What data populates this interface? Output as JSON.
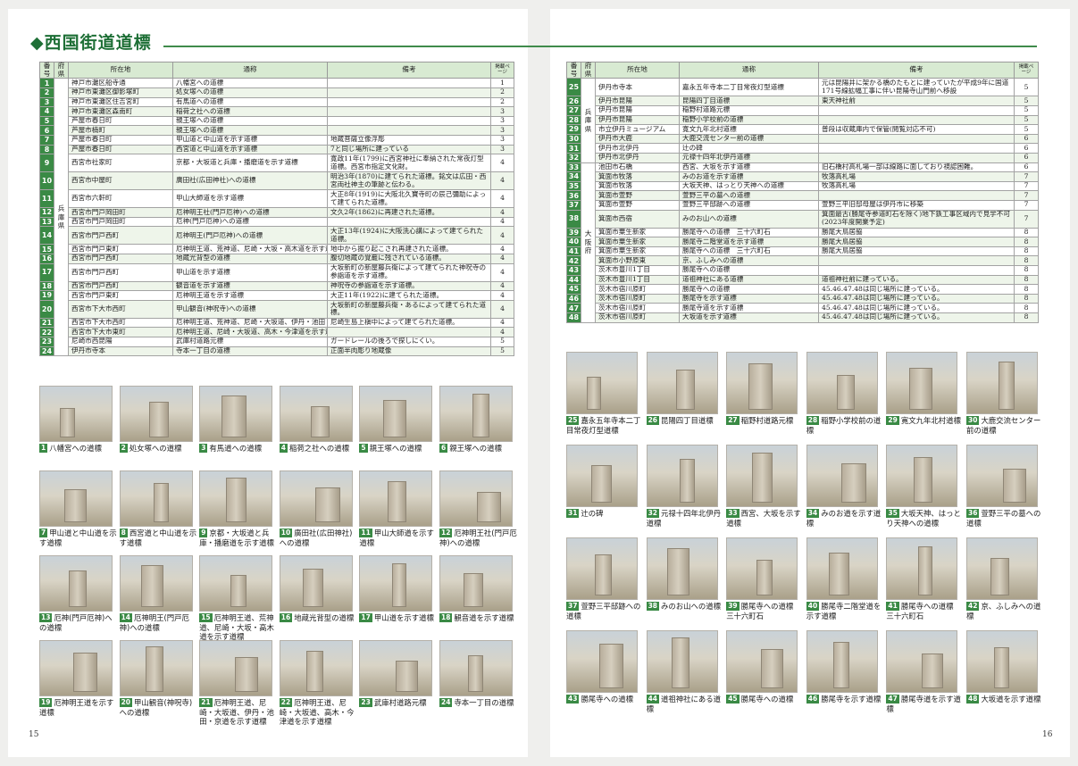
{
  "section_title": "◆西国街道道標",
  "table_headers": {
    "num": "番号",
    "pref": "府県",
    "loc": "所在地",
    "name": "通称",
    "note": "備考",
    "page": "掲載ページ"
  },
  "left_pref": "兵庫県",
  "right_prefs": [
    {
      "label": "兵庫県",
      "span": 8
    },
    {
      "label": "大阪府",
      "span": 16
    }
  ],
  "left_rows": [
    {
      "n": "1",
      "loc": "神戸市灘区船寺通",
      "name": "八幡宮への道標",
      "note": "",
      "page": "1"
    },
    {
      "n": "2",
      "loc": "神戸市東灘区御影塚町",
      "name": "処女塚への道標",
      "note": "",
      "page": "2"
    },
    {
      "n": "3",
      "loc": "神戸市東灘区住吉宮町",
      "name": "有馬道への道標",
      "note": "",
      "page": "2"
    },
    {
      "n": "4",
      "loc": "神戸市東灘区森南町",
      "name": "稲荷之社への道標",
      "note": "",
      "page": "3"
    },
    {
      "n": "5",
      "loc": "芦屋市春日町",
      "name": "親王塚への道標",
      "note": "",
      "page": "3"
    },
    {
      "n": "6",
      "loc": "芦屋市楠町",
      "name": "親王塚への道標",
      "note": "",
      "page": "3"
    },
    {
      "n": "7",
      "loc": "芦屋市春日町",
      "name": "甲山道と中山道を示す道標",
      "note": "地蔵菩薩立像浮彫",
      "page": "3"
    },
    {
      "n": "8",
      "loc": "芦屋市春日町",
      "name": "西宮道と中山道を示す道標",
      "note": "7と同じ場所に建っている",
      "page": "3"
    },
    {
      "n": "9",
      "loc": "西宮市社家町",
      "name": "京都・大坂道と兵庫・播磨道を示す道標",
      "note": "寛政11年(1799)に西宮神社に奉納された常夜灯型道標。西宮市指定文化財。",
      "page": "4"
    },
    {
      "n": "10",
      "loc": "西宮市中屋町",
      "name": "廣田社(広田神社)への道標",
      "note": "明治3年(1870)に建てられた道標。銘文は広田・西宮両社神主の筆跡と伝わる。",
      "page": "4"
    },
    {
      "n": "11",
      "loc": "西宮市六軒町",
      "name": "甲山大師道を示す道標",
      "note": "大正8年(1919)に大阪北久寶寺町の辰己彌助によって建てられた道標。",
      "page": "4"
    },
    {
      "n": "12",
      "loc": "西宮市門戸岡田町",
      "name": "厄神明王社(門戸厄神)への道標",
      "note": "文久2年(1862)に再建された道標。",
      "page": "4"
    },
    {
      "n": "13",
      "loc": "西宮市門戸岡田町",
      "name": "厄神(門戸厄神)への道標",
      "note": "",
      "page": "4"
    },
    {
      "n": "14",
      "loc": "西宮市門戸西町",
      "name": "厄神明王(門戸厄神)への道標",
      "note": "大正13年(1924)に大阪洗心講によって建てられた道標。",
      "page": "4"
    },
    {
      "n": "15",
      "loc": "西宮市門戸東町",
      "name": "厄神明王道、荒神道、尼崎・大坂・高木道を示す道標",
      "note": "地中から掘り起こされ再建された道標。",
      "page": "4"
    },
    {
      "n": "16",
      "loc": "西宮市門戸西町",
      "name": "地蔵光背型の道標",
      "note": "腹切地蔵の覚龕に残されている道標。",
      "page": "4"
    },
    {
      "n": "17",
      "loc": "西宮市門戸西町",
      "name": "甲山道を示す道標",
      "note": "大坂新町の新屋藤兵衛によって建てられた神呪寺の参詣道を示す道標。",
      "page": "4"
    },
    {
      "n": "18",
      "loc": "西宮市門戸西町",
      "name": "観音道を示す道標",
      "note": "神呪寺の参詣道を示す道標。",
      "page": "4"
    },
    {
      "n": "19",
      "loc": "西宮市門戸東町",
      "name": "厄神明王道を示す道標",
      "note": "大正11年(1922)に建てられた道標。",
      "page": "4"
    },
    {
      "n": "20",
      "loc": "西宮市下大市西町",
      "name": "甲山観音(神呪寺)への道標",
      "note": "大坂新町の新屋藤兵衛・あるによって建てられた道標。",
      "page": "4"
    },
    {
      "n": "21",
      "loc": "西宮市下大市西町",
      "name": "厄神明王道、荒神道、尼崎・大坂道、伊丹・池田・京道を示す道標",
      "note": "尼崎生島上槇中によって建てられた道標。",
      "page": "4"
    },
    {
      "n": "22",
      "loc": "西宮市下大市東町",
      "name": "厄神明王道、尼崎・大坂道、高木・今津道を示す道標",
      "note": "",
      "page": "4"
    },
    {
      "n": "23",
      "loc": "尼崎市西昆陽",
      "name": "武庫村道路元標",
      "note": "ガードレールの後ろで探しにくい。",
      "page": "5"
    },
    {
      "n": "24",
      "loc": "伊丹市寺本",
      "name": "寺本一丁目の道標",
      "note": "正面半肉彫り地蔵像",
      "page": "5"
    }
  ],
  "right_rows": [
    {
      "n": "25",
      "loc": "伊丹市寺本",
      "name": "嘉永五年寺本二丁目常夜灯型道標",
      "note": "元は昆陽井に架かる橋のたもとに建っていたが平成9年に国道171号線拡幅工事に伴い昆陽寺山門前へ移設",
      "page": "5"
    },
    {
      "n": "26",
      "loc": "伊丹市昆陽",
      "name": "昆陽四丁目道標",
      "note": "東天神社前",
      "page": "5"
    },
    {
      "n": "27",
      "loc": "伊丹市昆陽",
      "name": "稲野村道路元標",
      "note": "",
      "page": "5"
    },
    {
      "n": "28",
      "loc": "伊丹市昆陽",
      "name": "稲野小学校前の道標",
      "note": "",
      "page": "5"
    },
    {
      "n": "29",
      "loc": "市立伊丹ミュージアム",
      "name": "寛文九年北村道標",
      "note": "普段は収蔵庫内で保管(閲覧対応不可)",
      "page": "5"
    },
    {
      "n": "30",
      "loc": "伊丹市大鹿",
      "name": "大鹿交流センター前の道標",
      "note": "",
      "page": "6"
    },
    {
      "n": "31",
      "loc": "伊丹市北伊丹",
      "name": "辻の碑",
      "note": "",
      "page": "6"
    },
    {
      "n": "32",
      "loc": "伊丹市北伊丹",
      "name": "元禄十四年北伊丹道標",
      "note": "",
      "page": "6"
    },
    {
      "n": "33",
      "loc": "池田市石橋",
      "name": "西宮、大坂を示す道標",
      "note": "旧石橋村高札場一部は線路に面しており視認困難。",
      "page": "6"
    },
    {
      "n": "34",
      "loc": "箕面市牧落",
      "name": "みのお道を示す道標",
      "note": "牧落高札場",
      "page": "7"
    },
    {
      "n": "35",
      "loc": "箕面市牧落",
      "name": "大坂天神、はっとり天神への道標",
      "note": "牧落高札場",
      "page": "7"
    },
    {
      "n": "36",
      "loc": "箕面市萱野",
      "name": "萱野三平の墓への道標",
      "note": "",
      "page": "7"
    },
    {
      "n": "37",
      "loc": "箕面市萱野",
      "name": "萱野三平邸跡への道標",
      "note": "萱野三平旧邸母屋は伊丹市に移築",
      "page": "7"
    },
    {
      "n": "38",
      "loc": "箕面市西宿",
      "name": "みのお山への道標",
      "note": "箕面最古(勝尾寺参道町石を除く)地下鉄工事区域内で見学不可(2023年度開業予定)",
      "page": "7"
    },
    {
      "n": "39",
      "loc": "箕面市粟生新家",
      "name": "勝尾寺への道標　三十六町石",
      "note": "勝尾大鳥居脇",
      "page": "8"
    },
    {
      "n": "40",
      "loc": "箕面市粟生新家",
      "name": "勝尾寺二階堂道を示す道標",
      "note": "勝尾大鳥居脇",
      "page": "8"
    },
    {
      "n": "41",
      "loc": "箕面市粟生新家",
      "name": "勝尾寺への道標　三十六町石",
      "note": "勝尾大鳥居脇",
      "page": "8"
    },
    {
      "n": "42",
      "loc": "箕面市小野原東",
      "name": "京、ふしみへの道標",
      "note": "",
      "page": "8"
    },
    {
      "n": "43",
      "loc": "茨木市豊川1丁目",
      "name": "勝尾寺への道標",
      "note": "",
      "page": "8"
    },
    {
      "n": "44",
      "loc": "茨木市豊川1丁目",
      "name": "道祖神社にある道標",
      "note": "道祖神社前に建っている。",
      "page": "8"
    },
    {
      "n": "45",
      "loc": "茨木市宿川原町",
      "name": "勝尾寺への道標",
      "note": "45.46.47.48は同じ場所に建っている。",
      "page": "8"
    },
    {
      "n": "46",
      "loc": "茨木市宿川原町",
      "name": "勝尾寺を示す道標",
      "note": "45.46.47.48は同じ場所に建っている。",
      "page": "8"
    },
    {
      "n": "47",
      "loc": "茨木市宿川原町",
      "name": "勝尾寺道を示す道標",
      "note": "45.46.47.48は同じ場所に建っている。",
      "page": "8"
    },
    {
      "n": "48",
      "loc": "茨木市宿川原町",
      "name": "大坂道を示す道標",
      "note": "45.46.47.48は同じ場所に建っている。",
      "page": "8"
    }
  ],
  "left_captions": [
    {
      "n": "1",
      "text": "八幡宮への道標"
    },
    {
      "n": "2",
      "text": "処女塚への道標"
    },
    {
      "n": "3",
      "text": "有馬道への道標"
    },
    {
      "n": "4",
      "text": "稲荷之社への道標"
    },
    {
      "n": "5",
      "text": "親王塚への道標"
    },
    {
      "n": "6",
      "text": "親王塚への道標"
    },
    {
      "n": "7",
      "text": "甲山道と中山道を示す道標"
    },
    {
      "n": "8",
      "text": "西宮道と中山道を示す道標"
    },
    {
      "n": "9",
      "text": "京都・大坂道と兵庫・播磨道を示す道標"
    },
    {
      "n": "10",
      "text": "廣田社(広田神社)への道標"
    },
    {
      "n": "11",
      "text": "甲山大師道を示す道標"
    },
    {
      "n": "12",
      "text": "厄神明王社(門戸厄神)への道標"
    },
    {
      "n": "13",
      "text": "厄神(門戸厄神)への道標"
    },
    {
      "n": "14",
      "text": "厄神明王(門戸厄神)への道標"
    },
    {
      "n": "15",
      "text": "厄神明王道、荒神道、尼崎・大坂・高木道を示す道標"
    },
    {
      "n": "16",
      "text": "地蔵光背型の道標"
    },
    {
      "n": "17",
      "text": "甲山道を示す道標"
    },
    {
      "n": "18",
      "text": "観音道を示す道標"
    },
    {
      "n": "19",
      "text": "厄神明王道を示す道標"
    },
    {
      "n": "20",
      "text": "甲山観音(神呪寺)への道標"
    },
    {
      "n": "21",
      "text": "厄神明王道、尼崎・大坂道、伊丹・池田・京道を示す道標"
    },
    {
      "n": "22",
      "text": "厄神明王道、尼崎・大坂道、高木・今津道を示す道標"
    },
    {
      "n": "23",
      "text": "武庫村道路元標"
    },
    {
      "n": "24",
      "text": "寺本一丁目の道標"
    }
  ],
  "right_captions": [
    {
      "n": "25",
      "text": "嘉永五年寺本二丁目常夜灯型道標"
    },
    {
      "n": "26",
      "text": "昆陽四丁目道標"
    },
    {
      "n": "27",
      "text": "稲野村道路元標"
    },
    {
      "n": "28",
      "text": "稲野小学校前の道標"
    },
    {
      "n": "29",
      "text": "寛文九年北村道標"
    },
    {
      "n": "30",
      "text": "大鹿交流センター前の道標"
    },
    {
      "n": "31",
      "text": "辻の碑"
    },
    {
      "n": "32",
      "text": "元禄十四年北伊丹道標"
    },
    {
      "n": "33",
      "text": "西宮、大坂を示す道標"
    },
    {
      "n": "34",
      "text": "みのお道を示す道標"
    },
    {
      "n": "35",
      "text": "大坂天神、はっとり天神への道標"
    },
    {
      "n": "36",
      "text": "萱野三平の墓への道標"
    },
    {
      "n": "37",
      "text": "萱野三平邸跡への道標"
    },
    {
      "n": "38",
      "text": "みのお山への道標"
    },
    {
      "n": "39",
      "text": "勝尾寺への道標　三十六町石"
    },
    {
      "n": "40",
      "text": "勝尾寺二階堂道を示す道標"
    },
    {
      "n": "41",
      "text": "勝尾寺への道標　三十六町石"
    },
    {
      "n": "42",
      "text": "京、ふしみへの道標"
    },
    {
      "n": "43",
      "text": "勝尾寺への道標"
    },
    {
      "n": "44",
      "text": "道祖神社にある道標"
    },
    {
      "n": "45",
      "text": "勝尾寺への道標"
    },
    {
      "n": "46",
      "text": "勝尾寺を示す道標"
    },
    {
      "n": "47",
      "text": "勝尾寺道を示す道標"
    },
    {
      "n": "48",
      "text": "大坂道を示す道標"
    }
  ],
  "page_left": "15",
  "page_right": "16",
  "colors": {
    "accent": "#3a8a45",
    "header_bg": "#d8ead2",
    "title": "#1e6f36"
  }
}
